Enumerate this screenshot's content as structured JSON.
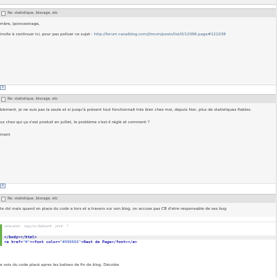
{
  "posts": [
    {
      "subject": "Re: statistique, blocage, etc",
      "lines": [
        "mbre, lponceoinage,",
        "invite à continuer ici, pour pas polluer ce sujet :"
      ],
      "link": "http://forum.canalblog.com/jforum/posts/list/0/12066.page#121038",
      "button": "R"
    },
    {
      "subject": "Re: statistique, blocage, etc",
      "lines": [
        "blement, je ne suis pas la seule et si jusqu'à présent tout fonctionnait très bien chez moi, depuis hier, plus de statistiques fiables.",
        "ux chez qui ça s'est produit en juillet, le problème s'est-il réglé et comment ?",
        "ment"
      ],
      "button": "R"
    },
    {
      "subject": "Re: statistique, blocage, etc",
      "lines": [
        "te dsl mais quand on place du code a tors et a travers sur son blog, on accuse pas CB d'etre responsable de ses bug"
      ],
      "code": {
        "tools": [
          "view plain",
          "copy to clipboard",
          "print",
          "?"
        ],
        "line1_tag": "</body></html>",
        "line2_open": "<a href=",
        "line2_href": "\"#\"",
        "line2_font": "><font color=",
        "line2_color": "\"#996666\"",
        "line2_text": ">Haut de Page",
        "line2_close": "</font></a>"
      },
      "after": "e vois du code placé apres les balises de fin de blog. Décolée"
    }
  ]
}
